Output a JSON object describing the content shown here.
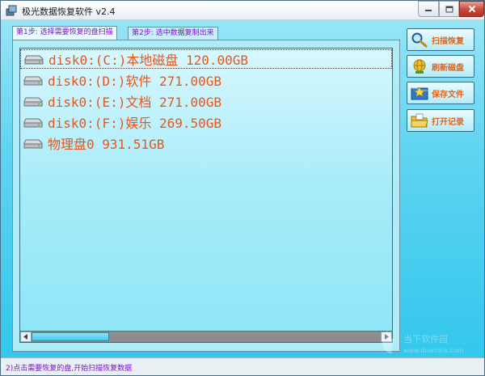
{
  "window": {
    "title": "极光数据恢复软件 v2.4"
  },
  "tabs": [
    {
      "label": "第1步: 选择需要恢复的盘扫描",
      "active": true
    },
    {
      "label": "第2步: 选中数据复制出来",
      "active": false
    }
  ],
  "disks": [
    {
      "label": "disk0:(C:)本地磁盘 120.00GB",
      "icon": "hard-drive-icon",
      "selected": true
    },
    {
      "label": "disk0:(D:)软件 271.00GB",
      "icon": "hard-drive-icon",
      "selected": false
    },
    {
      "label": "disk0:(E:)文档 271.00GB",
      "icon": "hard-drive-icon",
      "selected": false
    },
    {
      "label": "disk0:(F:)娱乐 269.50GB",
      "icon": "hard-drive-icon",
      "selected": false
    },
    {
      "label": "物理盘0 931.51GB",
      "icon": "hard-drive-icon",
      "selected": false
    }
  ],
  "actions": [
    {
      "label": "扫描恢复",
      "icon": "magnifier-icon"
    },
    {
      "label": "刷新磁盘",
      "icon": "refresh-globe-icon"
    },
    {
      "label": "保存文件",
      "icon": "save-folder-icon"
    },
    {
      "label": "打开记录",
      "icon": "open-folder-icon"
    }
  ],
  "status": {
    "text": "2)点击需要恢复的盘,开始扫描恢复数据"
  },
  "colors": {
    "accent_text": "#e8561b",
    "tab_text": "#7a14c8",
    "background": "#5fd4f1"
  }
}
